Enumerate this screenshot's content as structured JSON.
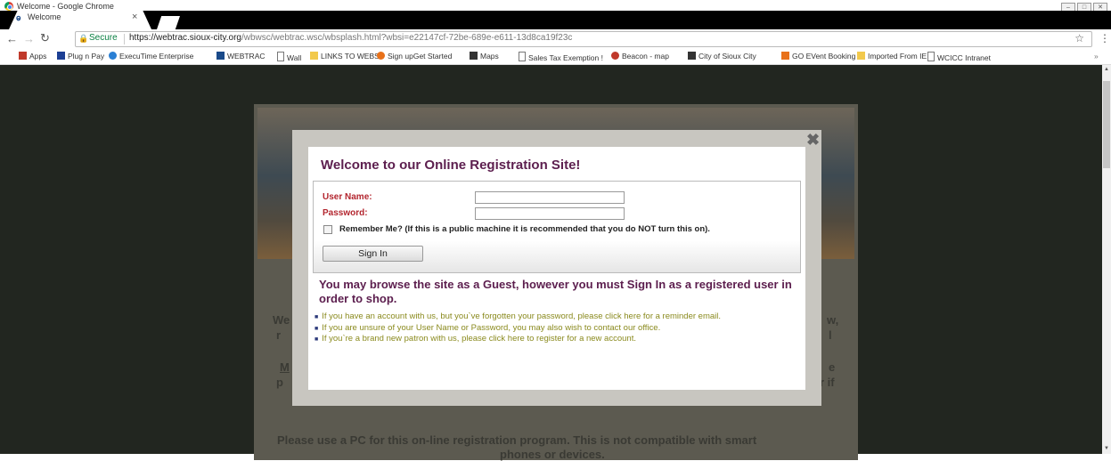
{
  "window": {
    "title": "Welcome - Google Chrome"
  },
  "tab": {
    "label": "Welcome",
    "close": "×"
  },
  "address": {
    "secure_label": "Secure",
    "url_host": "https://webtrac.sioux-city.org",
    "url_path": "/wbwsc/webtrac.wsc/wbsplash.html?wbsi=e22147cf-72be-689e-e611-13d8ca19f23c"
  },
  "bookmarks": [
    {
      "label": "Apps",
      "icon": "apps-grid-icon",
      "color": "#c0392b"
    },
    {
      "label": "Plug n Pay",
      "icon": "p-logo-icon",
      "color": "#1c3f94"
    },
    {
      "label": "ExecuTime Enterprise",
      "icon": "globe-icon",
      "color": "#2a7fd4"
    },
    {
      "label": "WEBTRAC",
      "icon": "webtrac-icon",
      "color": "#1a4a8a"
    },
    {
      "label": "Wall",
      "icon": "page-icon",
      "color": "#777777"
    },
    {
      "label": "LINKS TO WEBS",
      "icon": "folder-icon",
      "color": "#f2c94c"
    },
    {
      "label": "Sign upGet Started",
      "icon": "orange-circle-icon",
      "color": "#e8711a"
    },
    {
      "label": "Maps",
      "icon": "city-icon",
      "color": "#333333"
    },
    {
      "label": "Sales Tax Exemption !",
      "icon": "page-icon",
      "color": "#777777"
    },
    {
      "label": "Beacon - map",
      "icon": "beacon-icon",
      "color": "#c0392b"
    },
    {
      "label": "City of Sioux City",
      "icon": "city-icon",
      "color": "#333333"
    },
    {
      "label": "GO EVent Booking",
      "icon": "rss-icon",
      "color": "#e8711a"
    },
    {
      "label": "Imported From IE",
      "icon": "folder-icon",
      "color": "#f2c94c"
    },
    {
      "label": "WCICC Intranet",
      "icon": "page-icon",
      "color": "#777777"
    }
  ],
  "modal": {
    "heading": "Welcome to our Online Registration Site!",
    "username_label": "User Name:",
    "password_label": "Password:",
    "remember_label": "Remember Me? (If this is a public machine it is recommended that you do NOT turn this on).",
    "signin_label": "Sign In",
    "guest_text": "You may browse the site as a Guest, however you must Sign In as a registered user in order to shop.",
    "links": [
      "If you have an account with us, but you`ve forgotten your password, please click here for a reminder email.",
      "If you are unsure of your User Name or Password, you may also wish to contact our office.",
      "If you`re a brand new patron with us, please click here to register for a new account."
    ]
  },
  "background": {
    "line1_left": "We",
    "line1_right": "w,",
    "line2_left": "r",
    "line2_right": "l",
    "line3_left": "M",
    "line3_right": "e",
    "line4_left": "p",
    "line4_right": "r if",
    "bottom1": "Please use a PC for this on-line registration program. This is not compatible with smart",
    "bottom2": "phones or devices."
  }
}
